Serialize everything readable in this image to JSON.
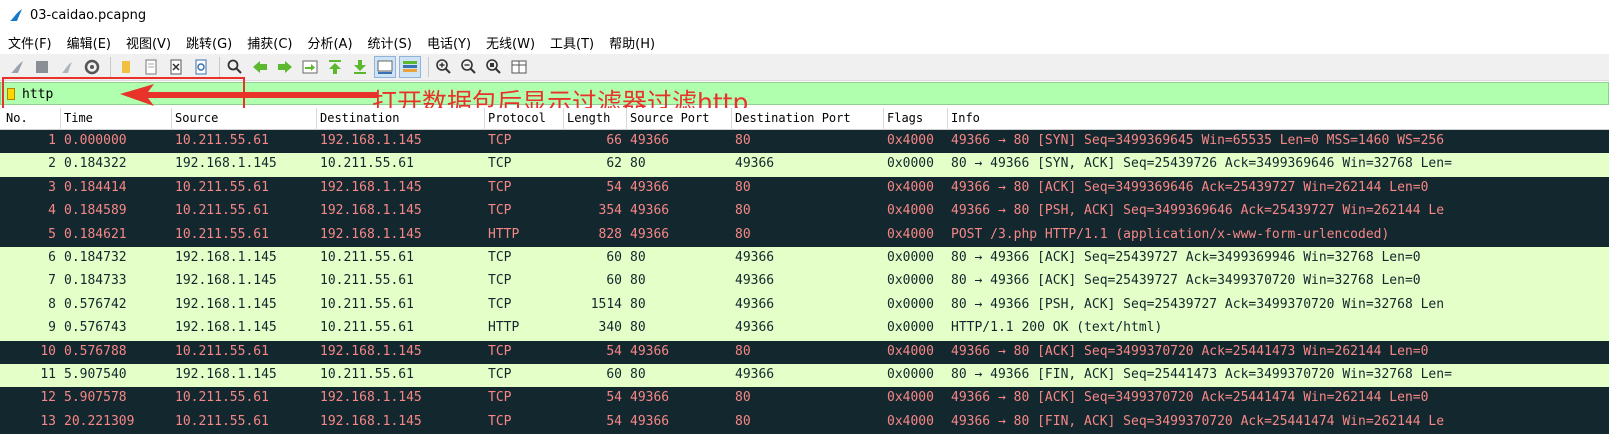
{
  "window": {
    "title": "03-caidao.pcapng"
  },
  "menu": [
    "文件(F)",
    "编辑(E)",
    "视图(V)",
    "跳转(G)",
    "捕获(C)",
    "分析(A)",
    "统计(S)",
    "电话(Y)",
    "无线(W)",
    "工具(T)",
    "帮助(H)"
  ],
  "toolbar": {
    "icons": [
      "shark-fin-start-icon",
      "stop-icon",
      "restart-icon",
      "options-gear-icon",
      "open-folder-icon",
      "save-file-icon",
      "close-file-icon",
      "reload-icon",
      "find-icon",
      "go-back-icon",
      "go-forward-icon",
      "go-to-packet-icon",
      "go-first-icon",
      "go-last-icon",
      "autoscroll-icon",
      "colorize-icon",
      "zoom-in-icon",
      "zoom-out-icon",
      "zoom-normal-icon",
      "resize-columns-icon"
    ]
  },
  "filter": {
    "value": "http"
  },
  "annotation": {
    "text": "打开数据包后显示过滤器过滤http",
    "color": "#e8332a"
  },
  "columns": [
    "No.",
    "Time",
    "Source",
    "Destination",
    "Protocol",
    "Length",
    "Source Port",
    "Destination Port",
    "Flags",
    "Info"
  ],
  "rows": [
    {
      "style": "dark",
      "no": "1",
      "time": "0.000000",
      "src": "10.211.55.61",
      "dst": "192.168.1.145",
      "proto": "TCP",
      "len": "66",
      "sport": "49366",
      "dport": "80",
      "flags": "0x4000",
      "info": "49366 → 80 [SYN] Seq=3499369645 Win=65535 Len=0 MSS=1460 WS=256"
    },
    {
      "style": "green",
      "no": "2",
      "time": "0.184322",
      "src": "192.168.1.145",
      "dst": "10.211.55.61",
      "proto": "TCP",
      "len": "62",
      "sport": "80",
      "dport": "49366",
      "flags": "0x0000",
      "info": "80 → 49366 [SYN, ACK] Seq=25439726 Ack=3499369646 Win=32768 Len="
    },
    {
      "style": "dark",
      "no": "3",
      "time": "0.184414",
      "src": "10.211.55.61",
      "dst": "192.168.1.145",
      "proto": "TCP",
      "len": "54",
      "sport": "49366",
      "dport": "80",
      "flags": "0x4000",
      "info": "49366 → 80 [ACK] Seq=3499369646 Ack=25439727 Win=262144 Len=0"
    },
    {
      "style": "dark",
      "no": "4",
      "time": "0.184589",
      "src": "10.211.55.61",
      "dst": "192.168.1.145",
      "proto": "TCP",
      "len": "354",
      "sport": "49366",
      "dport": "80",
      "flags": "0x4000",
      "info": "49366 → 80 [PSH, ACK] Seq=3499369646 Ack=25439727 Win=262144 Le"
    },
    {
      "style": "dark",
      "no": "5",
      "time": "0.184621",
      "src": "10.211.55.61",
      "dst": "192.168.1.145",
      "proto": "HTTP",
      "len": "828",
      "sport": "49366",
      "dport": "80",
      "flags": "0x4000",
      "info": "POST /3.php HTTP/1.1  (application/x-www-form-urlencoded)"
    },
    {
      "style": "green",
      "no": "6",
      "time": "0.184732",
      "src": "192.168.1.145",
      "dst": "10.211.55.61",
      "proto": "TCP",
      "len": "60",
      "sport": "80",
      "dport": "49366",
      "flags": "0x0000",
      "info": "80 → 49366 [ACK] Seq=25439727 Ack=3499369946 Win=32768 Len=0"
    },
    {
      "style": "green",
      "no": "7",
      "time": "0.184733",
      "src": "192.168.1.145",
      "dst": "10.211.55.61",
      "proto": "TCP",
      "len": "60",
      "sport": "80",
      "dport": "49366",
      "flags": "0x0000",
      "info": "80 → 49366 [ACK] Seq=25439727 Ack=3499370720 Win=32768 Len=0"
    },
    {
      "style": "green",
      "no": "8",
      "time": "0.576742",
      "src": "192.168.1.145",
      "dst": "10.211.55.61",
      "proto": "TCP",
      "len": "1514",
      "sport": "80",
      "dport": "49366",
      "flags": "0x0000",
      "info": "80 → 49366 [PSH, ACK] Seq=25439727 Ack=3499370720 Win=32768 Len"
    },
    {
      "style": "green",
      "no": "9",
      "time": "0.576743",
      "src": "192.168.1.145",
      "dst": "10.211.55.61",
      "proto": "HTTP",
      "len": "340",
      "sport": "80",
      "dport": "49366",
      "flags": "0x0000",
      "info": "HTTP/1.1 200 OK  (text/html)"
    },
    {
      "style": "dark",
      "no": "10",
      "time": "0.576788",
      "src": "10.211.55.61",
      "dst": "192.168.1.145",
      "proto": "TCP",
      "len": "54",
      "sport": "49366",
      "dport": "80",
      "flags": "0x4000",
      "info": "49366 → 80 [ACK] Seq=3499370720 Ack=25441473 Win=262144 Len=0"
    },
    {
      "style": "green",
      "no": "11",
      "time": "5.907540",
      "src": "192.168.1.145",
      "dst": "10.211.55.61",
      "proto": "TCP",
      "len": "60",
      "sport": "80",
      "dport": "49366",
      "flags": "0x0000",
      "info": "80 → 49366 [FIN, ACK] Seq=25441473 Ack=3499370720 Win=32768 Len="
    },
    {
      "style": "dark",
      "no": "12",
      "time": "5.907578",
      "src": "10.211.55.61",
      "dst": "192.168.1.145",
      "proto": "TCP",
      "len": "54",
      "sport": "49366",
      "dport": "80",
      "flags": "0x4000",
      "info": "49366 → 80 [ACK] Seq=3499370720 Ack=25441474 Win=262144 Len=0"
    },
    {
      "style": "dark",
      "no": "13",
      "time": "20.221309",
      "src": "10.211.55.61",
      "dst": "192.168.1.145",
      "proto": "TCP",
      "len": "54",
      "sport": "49366",
      "dport": "80",
      "flags": "0x4000",
      "info": "49366 → 80 [FIN, ACK] Seq=3499370720 Ack=25441474 Win=262144 Le"
    }
  ]
}
